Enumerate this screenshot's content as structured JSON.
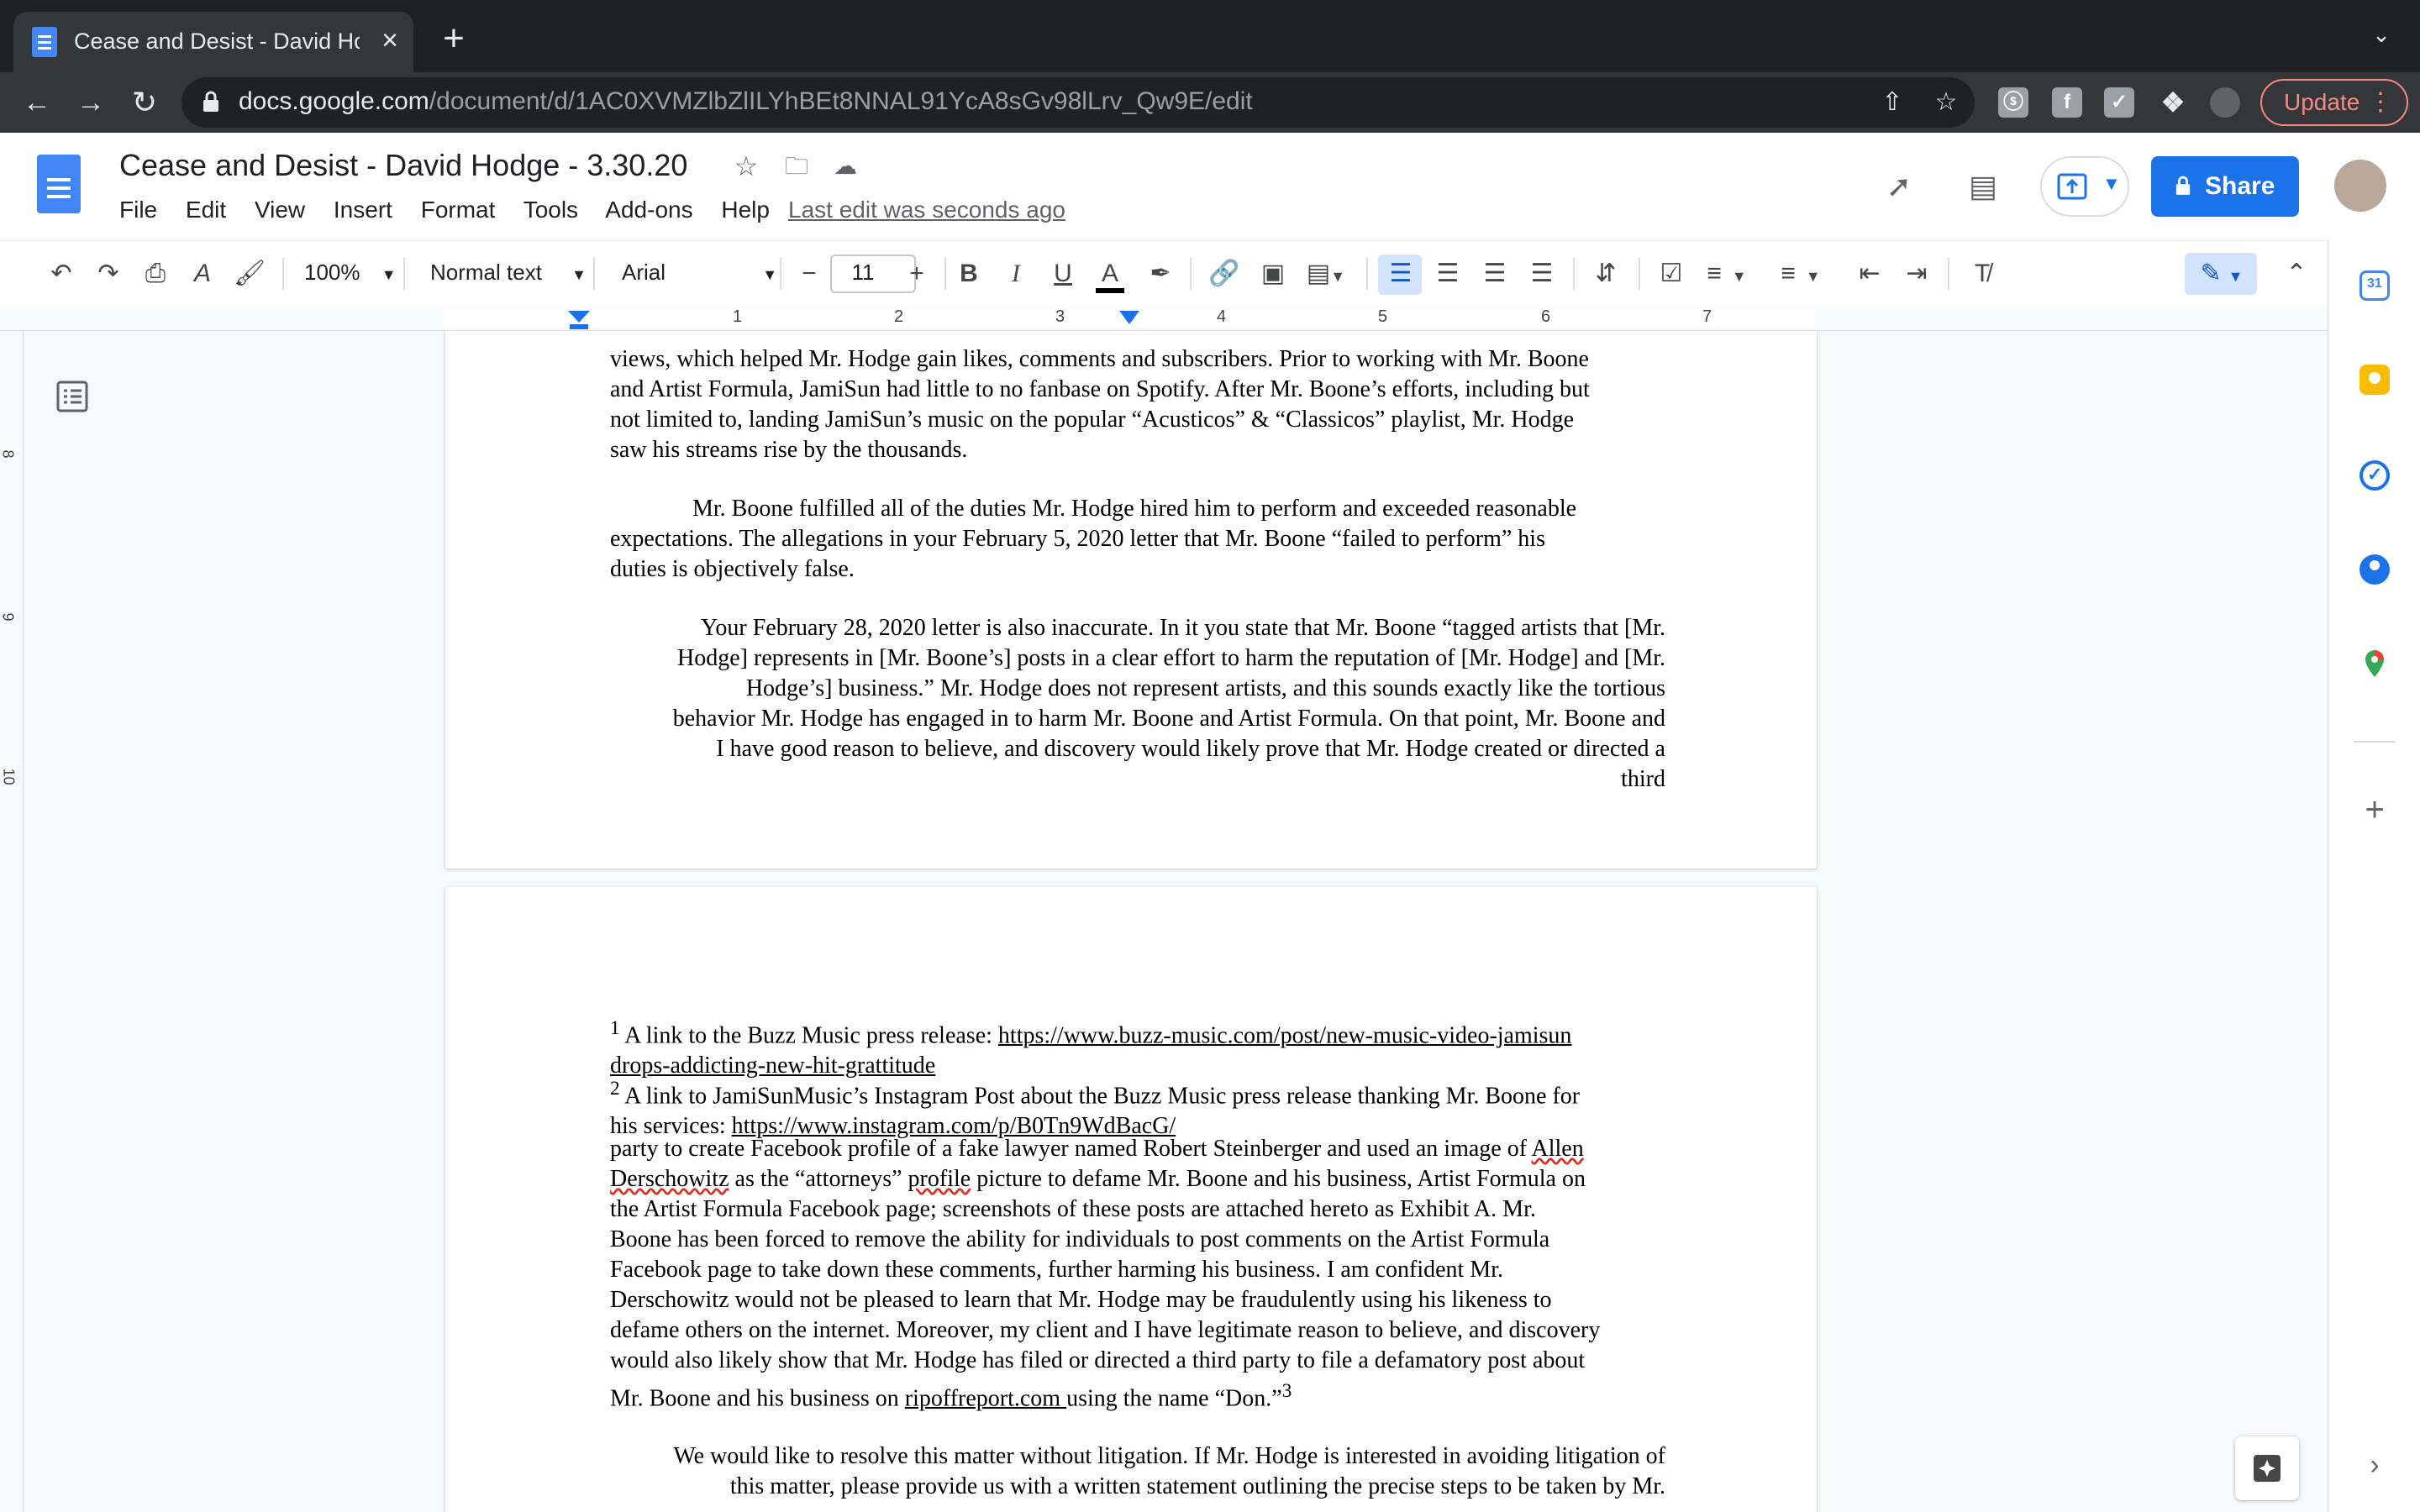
{
  "browser": {
    "tab_title": "Cease and Desist - David Hodg",
    "url_host": "docs.google.com",
    "url_path": "/document/d/1AC0XVMZlbZlILYhBEt8NNAL91YcA8sGv98lLrv_Qw9E/edit",
    "update_label": "Update"
  },
  "docs": {
    "title": "Cease and Desist - David Hodge - 3.30.20",
    "menu": [
      "File",
      "Edit",
      "View",
      "Insert",
      "Format",
      "Tools",
      "Add-ons",
      "Help"
    ],
    "last_edit": "Last edit was seconds ago",
    "share_label": "Share"
  },
  "format_toolbar": {
    "zoom": "100%",
    "style": "Normal text",
    "font": "Arial",
    "font_size": "11"
  },
  "ruler": {
    "numbers": [
      "1",
      "2",
      "3",
      "4",
      "5",
      "6",
      "7"
    ],
    "vertical_numbers": [
      "8",
      "9",
      "10"
    ]
  },
  "page1": {
    "para1": [
      "views, which helped Mr. Hodge gain likes, comments and subscribers. Prior to working with Mr. Boone",
      "and Artist Formula, JamiSun had little to no fanbase on Spotify. After Mr. Boone’s efforts, including but",
      "not limited to, landing JamiSun’s music on the popular “Acusticos” & “Classicos” playlist, Mr. Hodge",
      "saw his streams rise by the thousands."
    ],
    "para2": [
      "Mr. Boone fulfilled all of the duties Mr. Hodge hired him to perform and exceeded reasonable",
      "expectations. The allegations in your February 5, 2020 letter that Mr. Boone “failed to perform” his",
      "duties is objectively false."
    ],
    "para3": [
      "Your February 28, 2020 letter is also inaccurate. In it you state that Mr. Boone “tagged artists that [Mr.",
      "Hodge] represents in [Mr. Boone’s] posts in a clear effort to harm the reputation of [Mr. Hodge] and [Mr.",
      "Hodge’s] business.” Mr. Hodge does not represent artists, and this sounds exactly like the tortious",
      "behavior Mr. Hodge has engaged in to harm Mr. Boone and Artist Formula. On that point, Mr. Boone and",
      "I have good reason to believe, and discovery would likely prove that Mr. Hodge created or directed a",
      "third"
    ]
  },
  "page2": {
    "fn1_num": "1",
    "fn1_text": " A link to the Buzz Music press release: ",
    "fn1_link1": "https://www.buzz-music.com/post/new-music-video-jamisun",
    "fn1_link2": "drops-addicting-new-hit-grattitude",
    "fn2_num": "2",
    "fn2_text": " A link to JamiSunMusic’s Instagram Post about the Buzz Music press release thanking Mr. Boone for",
    "fn2_text2": "his services: ",
    "fn2_link": "https://www.instagram.com/p/B0Tn9WdBacG/",
    "body_line1_a": "party to create Facebook profile of a fake lawyer named Robert Steinberger and used an image of ",
    "body_line1_b": "Allen",
    "body_line2_a": "Derschowitz",
    "body_line2_b": " as the “attorneys” ",
    "body_line2_c": "profile",
    "body_line2_d": " picture to defame Mr. Boone and his business, Artist Formula on",
    "body_lines": [
      "the Artist Formula Facebook page; screenshots of these posts are attached hereto as Exhibit A. Mr.",
      "Boone has been forced to remove the ability for individuals to post comments on the Artist Formula",
      "Facebook page to take down these comments, further harming his business. I am confident Mr.",
      "Derschowitz would not be pleased to learn that Mr. Hodge may be fraudulently using his likeness to",
      "defame others on the internet. Moreover, my client and I have legitimate reason to believe, and discovery",
      "would also likely show that Mr. Hodge has filed or directed a third party to file a defamatory post about"
    ],
    "last_line_a": "Mr. Boone and his business on ",
    "last_line_link": "ripoffreport.com ",
    "last_line_b": "using the name “Don.”",
    "last_line_sup": "3",
    "closing_lines": [
      "We would like to resolve this matter without litigation. If Mr. Hodge is interested in avoiding litigation of",
      "this matter, please provide us with a written statement outlining the precise steps to be taken by Mr."
    ]
  }
}
